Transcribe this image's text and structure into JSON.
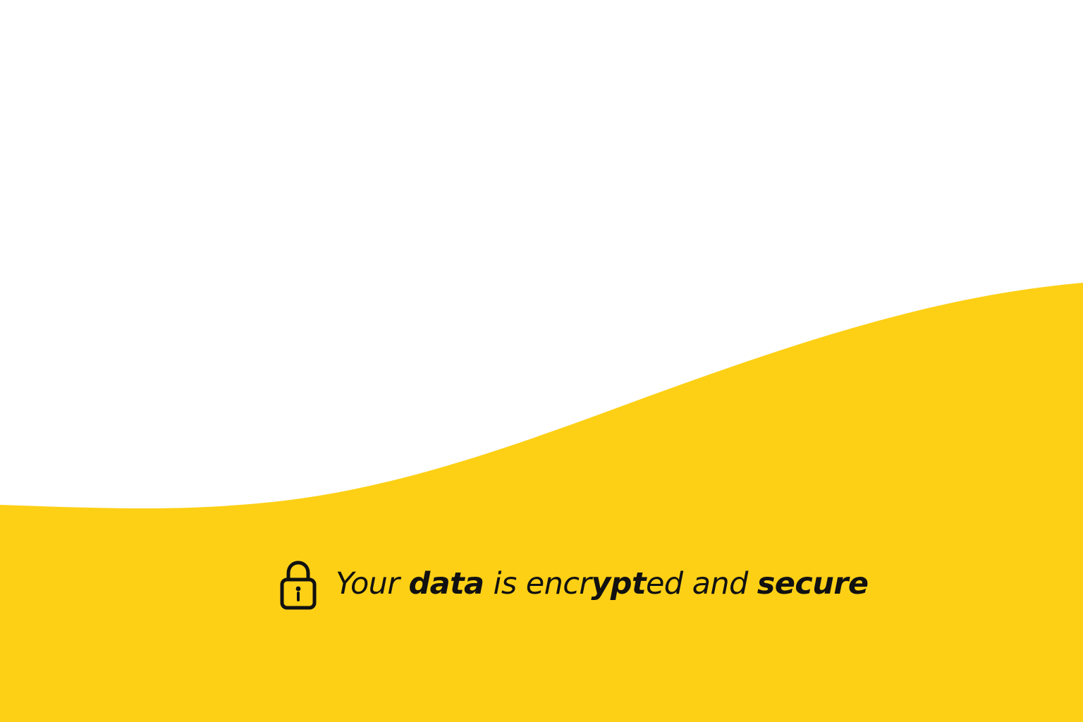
{
  "colors": {
    "background": "#ffffff",
    "accent": "#fdd016",
    "text": "#111111"
  },
  "security_notice": {
    "icon": "lock-icon",
    "parts": {
      "your": "Your",
      "space_1": " ",
      "data": "data",
      "is": " is ",
      "encr": "encr",
      "ypt": "ypt",
      "ed_and": "ed and ",
      "secure": "secure"
    }
  }
}
